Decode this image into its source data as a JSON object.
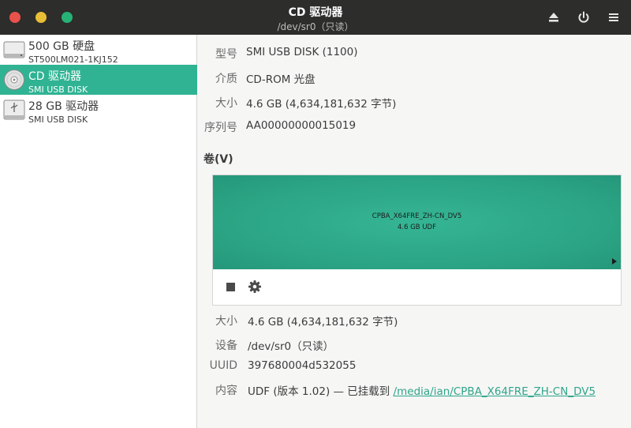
{
  "window": {
    "title": "CD 驱动器",
    "subtitle": "/dev/sr0（只读）",
    "icons": [
      "eject-icon",
      "power-icon",
      "hamburger-menu-icon"
    ]
  },
  "sidebar": {
    "items": [
      {
        "name": "500 GB 硬盘",
        "sub": "ST500LM021-1KJ152",
        "icon": "hard-disk-icon"
      },
      {
        "name": "CD 驱动器",
        "sub": "SMI USB DISK",
        "icon": "optical-disc-icon",
        "selected": true
      },
      {
        "name": "28 GB 驱动器",
        "sub": "SMI USB DISK",
        "icon": "usb-drive-icon"
      }
    ]
  },
  "drive_props": [
    {
      "label": "型号",
      "value": "SMI USB DISK (1100)"
    },
    {
      "label": "介质",
      "value": "CD-ROM 光盘"
    },
    {
      "label": "大小",
      "value": "4.6 GB (4,634,181,632 字节)"
    },
    {
      "label": "序列号",
      "value": "AA00000000015019"
    }
  ],
  "volumes": {
    "title": "卷(V)",
    "partition_name": "CPBA_X64FRE_ZH-CN_DV5",
    "partition_info": "4.6 GB UDF"
  },
  "volume_props": {
    "size": {
      "label": "大小",
      "value": "4.6 GB (4,634,181,632 字节)"
    },
    "device": {
      "label": "设备",
      "value": "/dev/sr0（只读）"
    },
    "uuid": {
      "label": "UUID",
      "value": "397680004d532055"
    },
    "contents": {
      "label": "内容",
      "value": "UDF (版本 1.02) — 已挂载到 ",
      "link": "/media/ian/CPBA_X64FRE_ZH-CN_DV5"
    }
  },
  "colors": {
    "accent": "#2fb393",
    "titlebar": "#2d2d2b",
    "close": "#e9524a",
    "minimize": "#e8be36",
    "maximize": "#27b276"
  }
}
